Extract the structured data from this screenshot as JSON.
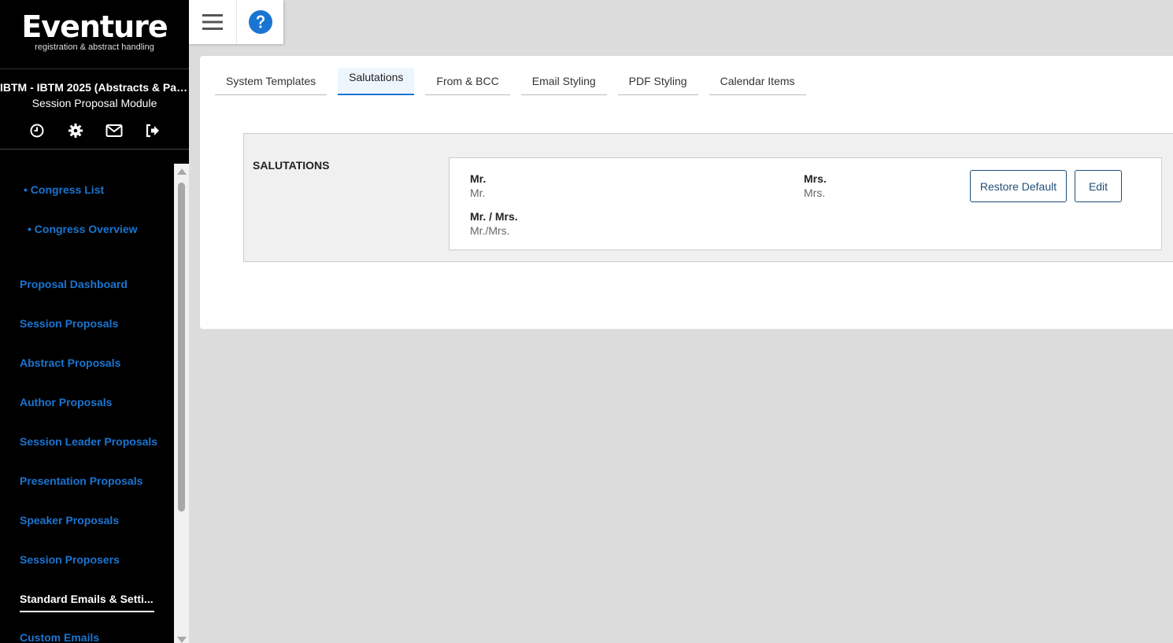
{
  "app": {
    "brand": "Eventure",
    "tagline": "registration & abstract handling",
    "congress_title": "IBTM - IBTM 2025 (Abstracts & Par...",
    "module": "Session Proposal Module"
  },
  "sidebar": {
    "icons": [
      "clock-icon",
      "gear-icon",
      "envelope-icon",
      "logout-icon"
    ],
    "items": [
      {
        "label": "• Congress List"
      },
      {
        "label": "• Congress Overview"
      },
      {
        "label": "Proposal Dashboard"
      },
      {
        "label": "Session Proposals"
      },
      {
        "label": "Abstract Proposals"
      },
      {
        "label": "Author Proposals"
      },
      {
        "label": "Session Leader Proposals"
      },
      {
        "label": "Presentation Proposals"
      },
      {
        "label": "Speaker Proposals"
      },
      {
        "label": "Session Proposers"
      },
      {
        "label": "Standard Emails & Setti..."
      },
      {
        "label": "Custom Emails"
      }
    ],
    "active_item": "Standard Emails & Setti..."
  },
  "toolbar": {
    "icons": [
      "hamburger-menu-icon",
      "help-icon"
    ]
  },
  "tabs": [
    {
      "label": "System Templates"
    },
    {
      "label": "Salutations"
    },
    {
      "label": "From & BCC"
    },
    {
      "label": "Email Styling"
    },
    {
      "label": "PDF Styling"
    },
    {
      "label": "Calendar Items"
    }
  ],
  "active_tab": "Salutations",
  "salutations": {
    "title": "SALUTATIONS",
    "entries": [
      {
        "label": "Mr.",
        "value": "Mr."
      },
      {
        "label": "Mrs.",
        "value": "Mrs."
      },
      {
        "label": "Mr. / Mrs.",
        "value": "Mr./Mrs."
      }
    ],
    "restore_label": "Restore Default",
    "edit_label": "Edit"
  },
  "colors": {
    "accent": "#1a75d2",
    "button_border": "#1f4e79",
    "sidebar_bg": "#000000",
    "page_bg": "#dcdcdc"
  }
}
